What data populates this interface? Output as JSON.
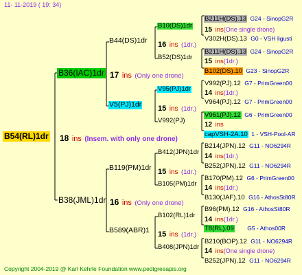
{
  "header": {
    "date": "11- 11-2019 ( 19: 34)"
  },
  "footer": {
    "copyright": "Copyright 2004-2019 @ Karl Kehrle Foundation   www.pedigreeapis.org"
  },
  "colors": {
    "background": "#ffffcc",
    "lines": "#000000",
    "ins": "#cc0000",
    "note": "#8a2be2",
    "library": "#0000cc"
  },
  "root": {
    "name": "B54(RL)1dr",
    "gen": "18",
    "ins": "ins",
    "note": "(Insem. with only one drone)"
  },
  "level2": [
    {
      "name": "B36(IAC)1dr",
      "gen": "17",
      "ins": "ins",
      "note": "(Only one drone)"
    },
    {
      "name": "B38(JML)1dr",
      "gen": "16",
      "ins": "ins",
      "note": "(Only one drone)"
    }
  ],
  "level3": [
    {
      "name": "B44(DS)1dr",
      "gen": "16",
      "ins": "ins",
      "note": "(1dr.)"
    },
    {
      "name": "V5(PJ)1dr",
      "gen": "15",
      "ins": "ins",
      "note": "(1dr.)"
    },
    {
      "name": "B119(PM)1dr",
      "gen": "15",
      "ins": "ins",
      "note": "(1dr.)"
    },
    {
      "name": "B589(ABR)1",
      "gen": "15",
      "ins": "ins",
      "note": "(1dr.)"
    }
  ],
  "level4": [
    {
      "name": "B10(DS)1dr",
      "gen": "15",
      "ins": "ins",
      "note": "(One single drone)"
    },
    {
      "name": "B52(DS)1dr",
      "gen": "15",
      "ins": "ins",
      "note": "(1dr.)"
    },
    {
      "name": "V95(PJ)1dr",
      "gen": "14",
      "ins": "ins",
      "note": "(1dr.)"
    },
    {
      "name": "V992(PJ)",
      "gen": "12",
      "ins": "ins",
      "note": ""
    },
    {
      "name": "B412(JPN)1dr",
      "gen": "14",
      "ins": "ins",
      "note": "(1dr.)"
    },
    {
      "name": "B105(PM)1dr",
      "gen": "14",
      "ins": "ins",
      "note": "(1dr.)"
    },
    {
      "name": "B102(RL)1dr",
      "gen": "14",
      "ins": "ins",
      "note": "(1dr.)"
    },
    {
      "name": "B408(JPN)1dr",
      "gen": "14",
      "ins": "ins",
      "note": "(One single drone)"
    }
  ],
  "level5": [
    {
      "name": "B211H(DS).13",
      "lib": "G24 - SinopG2R"
    },
    {
      "name": "V302H(DS).13",
      "lib": "G0 - VSH ligusti"
    },
    {
      "name": "B211H(DS).13",
      "lib": "G24 - SinopG2R"
    },
    {
      "name": "B102(DS).10",
      "lib": "G23 - SinopG2R"
    },
    {
      "name": "V992(PJ).12",
      "lib": "G7 - PrimGreen00"
    },
    {
      "name": "V964(PJ).12",
      "lib": "G7 - PrimGreen00"
    },
    {
      "name": "V961(PJ).12",
      "lib": "G6 - PrimGreen00"
    },
    {
      "name": "capVSH-2A.10",
      "lib": "1 - VSH-Pool-AR"
    },
    {
      "name": "B214(JPN).12",
      "lib": "G11 - NO6294R"
    },
    {
      "name": "B252(JPN).12",
      "lib": "G11 - NO6294R"
    },
    {
      "name": "B170(PM).12",
      "lib": "G6 - PrimGreen00"
    },
    {
      "name": "B130(JAF).10",
      "lib": "G16 - AthosSt80R"
    },
    {
      "name": "B96(PM).12",
      "lib": "G16 - AthosSt80R"
    },
    {
      "name": "T8(RL).09",
      "lib": "G5 - Athos00R"
    },
    {
      "name": "B210(BOP).12",
      "lib": "G11 - NO6294R"
    },
    {
      "name": "B252(JPN).12",
      "lib": "G11 - NO6294R"
    }
  ]
}
